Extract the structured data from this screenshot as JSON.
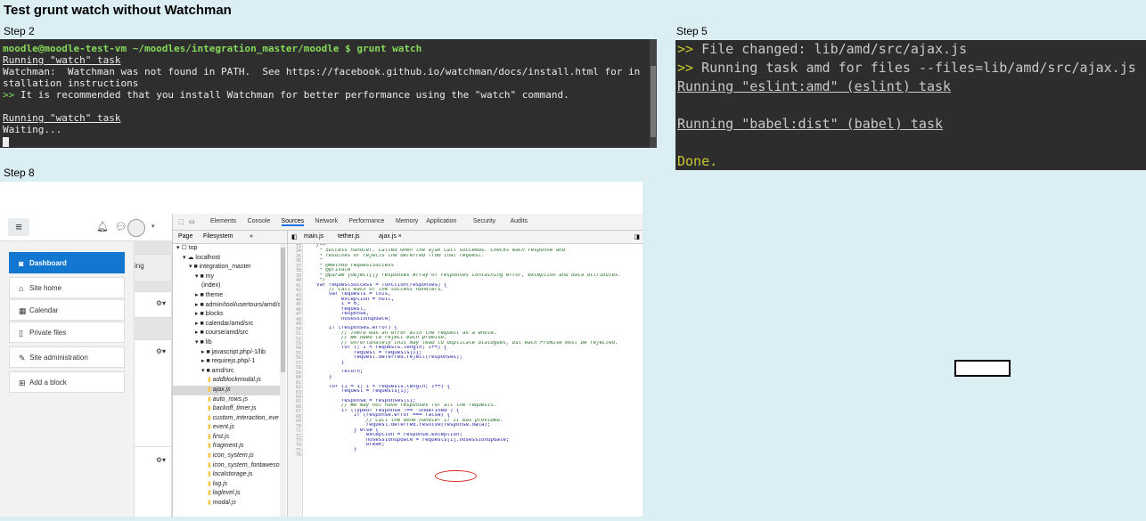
{
  "page_title": "Test grunt watch without Watchman",
  "step2": {
    "label": "Step 2",
    "lines": [
      {
        "text": "moodle@moodle-test-vm ~/moodles/integration_master/moodle $ grunt watch",
        "style": "prompt"
      },
      {
        "text": "Running \"watch\" task",
        "style": "underline"
      },
      {
        "text": "Watchman:  Watchman was not found in PATH.  See https://facebook.github.io/watchman/docs/install.html for in",
        "style": "plain"
      },
      {
        "text": "stallation instructions",
        "style": "plain"
      },
      {
        "text": ">> It is recommended that you install Watchman for better performance using the \"watch\" command.",
        "style": "warn"
      },
      {
        "text": "",
        "style": "plain"
      },
      {
        "text": "Running \"watch\" task",
        "style": "underline"
      },
      {
        "text": "Waiting...",
        "style": "plain"
      }
    ]
  },
  "step5": {
    "label": "Step 5",
    "lines": [
      {
        "prefix": ">>",
        "text": " File changed: lib/amd/src/ajax.js",
        "style": "plain"
      },
      {
        "prefix": ">>",
        "text": " Running task amd for files --files=lib/amd/src/ajax.js",
        "style": "plain"
      },
      {
        "prefix": "",
        "text": "Running \"eslint:amd\" (eslint) task",
        "style": "underline"
      },
      {
        "prefix": "",
        "text": "",
        "style": "plain"
      },
      {
        "prefix": "",
        "text": "Running \"babel:dist\" (babel) task",
        "style": "underline"
      },
      {
        "prefix": "",
        "text": "",
        "style": "plain"
      },
      {
        "prefix": "",
        "text": "Done.",
        "style": "done"
      }
    ]
  },
  "step8": {
    "label": "Step 8",
    "moodle": {
      "nav": [
        {
          "label": "Dashboard",
          "icon": "dashboard-icon",
          "glyph": "◙",
          "active": true
        },
        {
          "label": "Site home",
          "icon": "home-icon",
          "glyph": "⌂",
          "active": false
        },
        {
          "label": "Calendar",
          "icon": "calendar-icon",
          "glyph": "▦",
          "active": false
        },
        {
          "label": "Private files",
          "icon": "file-icon",
          "glyph": "▯",
          "active": false
        },
        {
          "label": "Site administration",
          "icon": "wrench-icon",
          "glyph": "✎",
          "active": false
        },
        {
          "label": "Add a block",
          "icon": "plus-square-icon",
          "glyph": "⊞",
          "active": false
        }
      ],
      "main_card_text": "ing"
    },
    "devtools": {
      "tabs": [
        "Elements",
        "Console",
        "Sources",
        "Network",
        "Performance",
        "Memory",
        "Application",
        "Security",
        "Audits"
      ],
      "active_tab": "Sources",
      "navigator_tabs": [
        "Page",
        "Filesystem",
        "»"
      ],
      "file_tabs": [
        "main.js",
        "tether.js",
        "ajax.js ×"
      ],
      "tree": [
        {
          "indent": 0,
          "kind": "frame",
          "text": "▾ ☐ top"
        },
        {
          "indent": 1,
          "kind": "cloud",
          "text": "▾ ☁ localhost"
        },
        {
          "indent": 2,
          "kind": "folder",
          "text": "▾ ■ integration_master"
        },
        {
          "indent": 3,
          "kind": "folder",
          "text": "▾ ■ my"
        },
        {
          "indent": 4,
          "kind": "doc",
          "text": "(index)"
        },
        {
          "indent": 3,
          "kind": "folder",
          "text": "▸ ■ theme"
        },
        {
          "indent": 3,
          "kind": "folder",
          "text": "▸ ■ admin/tool/usertours/amd/s"
        },
        {
          "indent": 3,
          "kind": "folder",
          "text": "▸ ■ blocks"
        },
        {
          "indent": 3,
          "kind": "folder",
          "text": "▸ ■ calendar/amd/src"
        },
        {
          "indent": 3,
          "kind": "folder",
          "text": "▸ ■ course/amd/src"
        },
        {
          "indent": 3,
          "kind": "folder",
          "text": "▾ ■ lib"
        },
        {
          "indent": 4,
          "kind": "folder",
          "text": "▸ ■ javascript.php/-1/lib"
        },
        {
          "indent": 4,
          "kind": "folder",
          "text": "▸ ■ requirejs.php/-1"
        },
        {
          "indent": 4,
          "kind": "folder",
          "text": "▾ ■ amd/src"
        },
        {
          "indent": 5,
          "kind": "file",
          "text": "addblockmodal.js"
        },
        {
          "indent": 5,
          "kind": "file",
          "text": "ajax.js",
          "selected": true
        },
        {
          "indent": 5,
          "kind": "file",
          "text": "auto_rows.js"
        },
        {
          "indent": 5,
          "kind": "file",
          "text": "backoff_timer.js"
        },
        {
          "indent": 5,
          "kind": "file",
          "text": "custom_interaction_eve"
        },
        {
          "indent": 5,
          "kind": "file",
          "text": "event.js"
        },
        {
          "indent": 5,
          "kind": "file",
          "text": "first.js"
        },
        {
          "indent": 5,
          "kind": "file",
          "text": "fragment.js"
        },
        {
          "indent": 5,
          "kind": "file",
          "text": "icon_system.js"
        },
        {
          "indent": 5,
          "kind": "file",
          "text": "icon_system_fontaweso"
        },
        {
          "indent": 5,
          "kind": "file",
          "text": "localstorage.js"
        },
        {
          "indent": 5,
          "kind": "file",
          "text": "log.js"
        },
        {
          "indent": 5,
          "kind": "file",
          "text": "loglevel.js"
        },
        {
          "indent": 5,
          "kind": "file",
          "text": "modal.js"
        }
      ],
      "code_lines": [
        {
          "n": "33",
          "t": "    /**",
          "k": "c"
        },
        {
          "n": "34",
          "t": "     * Success handler. Called when the ajax call succeeds. Checks each response and",
          "k": "c"
        },
        {
          "n": "35",
          "t": "     * resolves or rejects the deferred from that request.",
          "k": "c"
        },
        {
          "n": "36",
          "t": "     *",
          "k": "c"
        },
        {
          "n": "37",
          "t": "     * @method requestSuccess",
          "k": "c"
        },
        {
          "n": "38",
          "t": "     * @private",
          "k": "c"
        },
        {
          "n": "39",
          "t": "     * @param {Object[]} responses Array of responses containing error, exception and data attributes.",
          "k": "c"
        },
        {
          "n": "40",
          "t": "     */",
          "k": "c"
        },
        {
          "n": "41",
          "t": "    var requestSuccess = function(responses) {",
          "k": "p"
        },
        {
          "n": "42",
          "t": "        // Call each of the success handlers.",
          "k": "c"
        },
        {
          "n": "43",
          "t": "        var requests = this,",
          "k": "p"
        },
        {
          "n": "44",
          "t": "            exception = null,",
          "k": "p"
        },
        {
          "n": "45",
          "t": "            i = 0,",
          "k": "p"
        },
        {
          "n": "46",
          "t": "            request,",
          "k": "p"
        },
        {
          "n": "47",
          "t": "            response,",
          "k": "p"
        },
        {
          "n": "48",
          "t": "            nosessionupdate;",
          "k": "p"
        },
        {
          "n": "49",
          "t": "",
          "k": "p"
        },
        {
          "n": "50",
          "t": "        if (responses.error) {",
          "k": "p"
        },
        {
          "n": "51",
          "t": "            // There was an error with the request as a whole.",
          "k": "c"
        },
        {
          "n": "52",
          "t": "            // We need to reject each promise.",
          "k": "c"
        },
        {
          "n": "53",
          "t": "            // Unfortunately this may lead to duplicate dialogues, but each Promise must be rejected.",
          "k": "c"
        },
        {
          "n": "54",
          "t": "            for (; i < requests.length; i++) {",
          "k": "p"
        },
        {
          "n": "55",
          "t": "                request = requests[i];",
          "k": "p"
        },
        {
          "n": "56",
          "t": "                request.deferred.reject(responses);",
          "k": "p"
        },
        {
          "n": "57",
          "t": "            }",
          "k": "p"
        },
        {
          "n": "58",
          "t": "",
          "k": "p"
        },
        {
          "n": "59",
          "t": "            return;",
          "k": "p"
        },
        {
          "n": "60",
          "t": "        }",
          "k": "p"
        },
        {
          "n": "61",
          "t": "",
          "k": "p"
        },
        {
          "n": "62",
          "t": "        for (i = 1; i < requests.length; i++) {",
          "k": "p"
        },
        {
          "n": "63",
          "t": "            request = requests[i];",
          "k": "p"
        },
        {
          "n": "64",
          "t": "",
          "k": "p"
        },
        {
          "n": "65",
          "t": "            response = responses[i];",
          "k": "p"
        },
        {
          "n": "66",
          "t": "            // We may not have responses for all the requests.",
          "k": "c"
        },
        {
          "n": "67",
          "t": "            if (typeof response !== \"undefined\") {",
          "k": "p"
        },
        {
          "n": "68",
          "t": "                if (response.error === false) {",
          "k": "p"
        },
        {
          "n": "69",
          "t": "                    // Call the done handler if it was provided.",
          "k": "c"
        },
        {
          "n": "70",
          "t": "                    request.deferred.resolve(response.data);",
          "k": "p"
        },
        {
          "n": "71",
          "t": "                } else {",
          "k": "p"
        },
        {
          "n": "72",
          "t": "                    exception = response.exception;",
          "k": "p"
        },
        {
          "n": "73",
          "t": "                    nosessionupdate = requests[i].nosessionupdate;",
          "k": "p"
        },
        {
          "n": "74",
          "t": "                    break;",
          "k": "p"
        },
        {
          "n": "75",
          "t": "                }",
          "k": "p"
        },
        {
          "n": "76",
          "t": "",
          "k": "p"
        }
      ]
    }
  },
  "colors": {
    "background": "#dbeef4",
    "terminal_green": "#86d95a",
    "terminal_yellow": "#c8c832",
    "moodle_active": "#1177d1",
    "annotation_red": "#d9261c"
  }
}
